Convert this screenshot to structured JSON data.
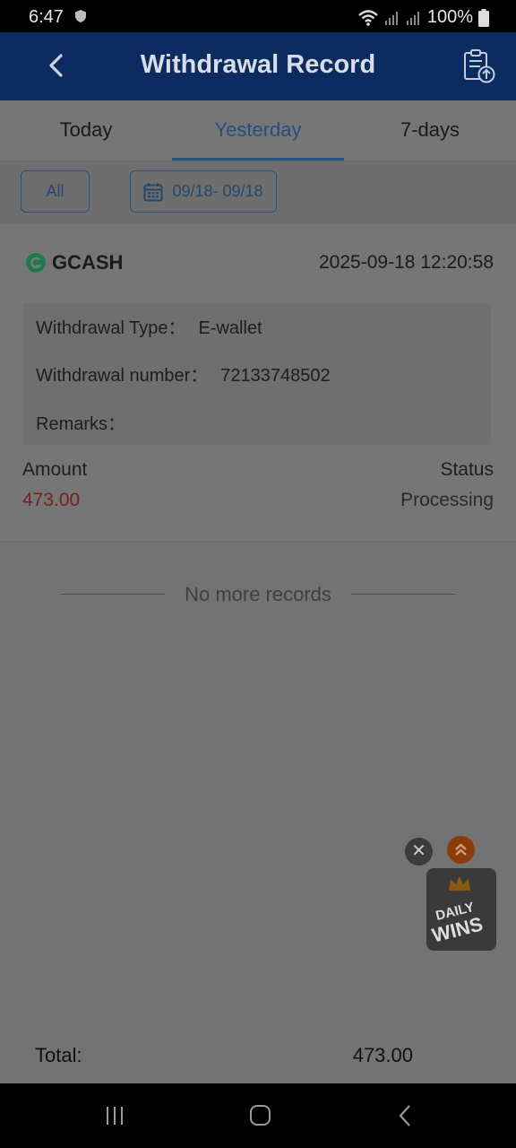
{
  "status_bar": {
    "time": "6:47",
    "battery": "100%"
  },
  "app_bar": {
    "title": "Withdrawal Record"
  },
  "tabs": [
    {
      "label": "Today"
    },
    {
      "label": "Yesterday"
    },
    {
      "label": "7-days"
    }
  ],
  "active_tab": "Yesterday",
  "filters": {
    "all_label": "All",
    "date_range": "09/18- 09/18"
  },
  "record": {
    "provider": "GCASH",
    "datetime": "2025-09-18 12:20:58",
    "type_label": "Withdrawal Type：",
    "type_value": "E-wallet",
    "number_label": "Withdrawal number：",
    "number_value": "72133748502",
    "remarks_label": "Remarks：",
    "amount_label": "Amount",
    "amount_value": "473.00",
    "status_label": "Status",
    "status_value": "Processing"
  },
  "no_more": "No more records",
  "floating_ad": {
    "close": "✕",
    "line1": "DAILY",
    "line2": "WINS"
  },
  "total": {
    "label": "Total:",
    "value": "473.00"
  },
  "colors": {
    "app_bar": "#0b2b61",
    "accent": "#25507f",
    "amount": "#7a1f1a"
  }
}
